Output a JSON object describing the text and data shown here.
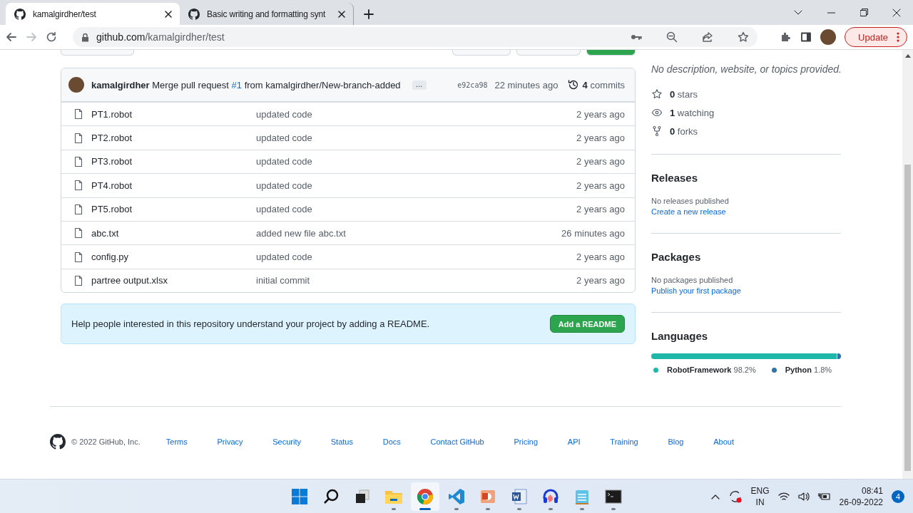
{
  "browser": {
    "tabs": [
      {
        "title": "kamalgirdher/test",
        "selected": true
      },
      {
        "title": "Basic writing and formatting synt",
        "selected": false
      }
    ],
    "url_host": "github.com",
    "url_path": "/kamalgirdher/test",
    "update_label": "Update"
  },
  "commit": {
    "author": "kamalgirdher",
    "message_before": "Merge pull request",
    "pr": "#1",
    "message_after": "from kamalgirdher/New-branch-added",
    "more": "…",
    "sha": "e92ca98",
    "time": "22 minutes ago",
    "commits_count": "4",
    "commits_label": "commits"
  },
  "files": [
    {
      "name": "PT1.robot",
      "message": "updated code",
      "time": "2 years ago"
    },
    {
      "name": "PT2.robot",
      "message": "updated code",
      "time": "2 years ago"
    },
    {
      "name": "PT3.robot",
      "message": "updated code",
      "time": "2 years ago"
    },
    {
      "name": "PT4.robot",
      "message": "updated code",
      "time": "2 years ago"
    },
    {
      "name": "PT5.robot",
      "message": "updated code",
      "time": "2 years ago"
    },
    {
      "name": "abc.txt",
      "message": "added new file abc.txt",
      "time": "26 minutes ago"
    },
    {
      "name": "config.py",
      "message": "updated code",
      "time": "2 years ago"
    },
    {
      "name": "partree output.xlsx",
      "message": "initial commit",
      "time": "2 years ago"
    }
  ],
  "readme_banner": {
    "text": "Help people interested in this repository understand your project by adding a README.",
    "button": "Add a README"
  },
  "sidebar": {
    "description": "No description, website, or topics provided.",
    "stats": [
      {
        "kind": "star",
        "count": "0",
        "label": "stars"
      },
      {
        "kind": "eye",
        "count": "1",
        "label": "watching"
      },
      {
        "kind": "fork",
        "count": "0",
        "label": "forks"
      }
    ],
    "sections": [
      {
        "title": "Releases",
        "note": "No releases published",
        "link": "Create a new release"
      },
      {
        "title": "Packages",
        "note": "No packages published",
        "link": "Publish your first package"
      }
    ],
    "languages_title": "Languages",
    "languages": [
      {
        "name": "RobotFramework",
        "percent": "98.2%",
        "color": "#1fb8a8",
        "level": 0.982
      },
      {
        "name": "Python",
        "percent": "1.8%",
        "color": "#3572a5",
        "level": 0.018
      }
    ]
  },
  "footer": {
    "copyright": "© 2022 GitHub, Inc.",
    "links": [
      "Terms",
      "Privacy",
      "Security",
      "Status",
      "Docs",
      "Contact GitHub",
      "Pricing",
      "API",
      "Training",
      "Blog",
      "About"
    ]
  },
  "taskbar": {
    "apps": [
      {
        "kind": "start",
        "active": false
      },
      {
        "kind": "search",
        "active": false
      },
      {
        "kind": "taskview",
        "active": false
      },
      {
        "kind": "folder",
        "active": false
      },
      {
        "kind": "chrome",
        "active": true
      },
      {
        "kind": "vscode",
        "active": false
      },
      {
        "kind": "slides",
        "active": false
      },
      {
        "kind": "word",
        "active": false
      },
      {
        "kind": "audio",
        "active": false
      },
      {
        "kind": "notepad",
        "active": false
      },
      {
        "kind": "terminal",
        "active": false
      }
    ],
    "lang_top": "ENG",
    "lang_bottom": "IN",
    "time": "08:41",
    "date": "26-09-2022",
    "badge": "4"
  }
}
